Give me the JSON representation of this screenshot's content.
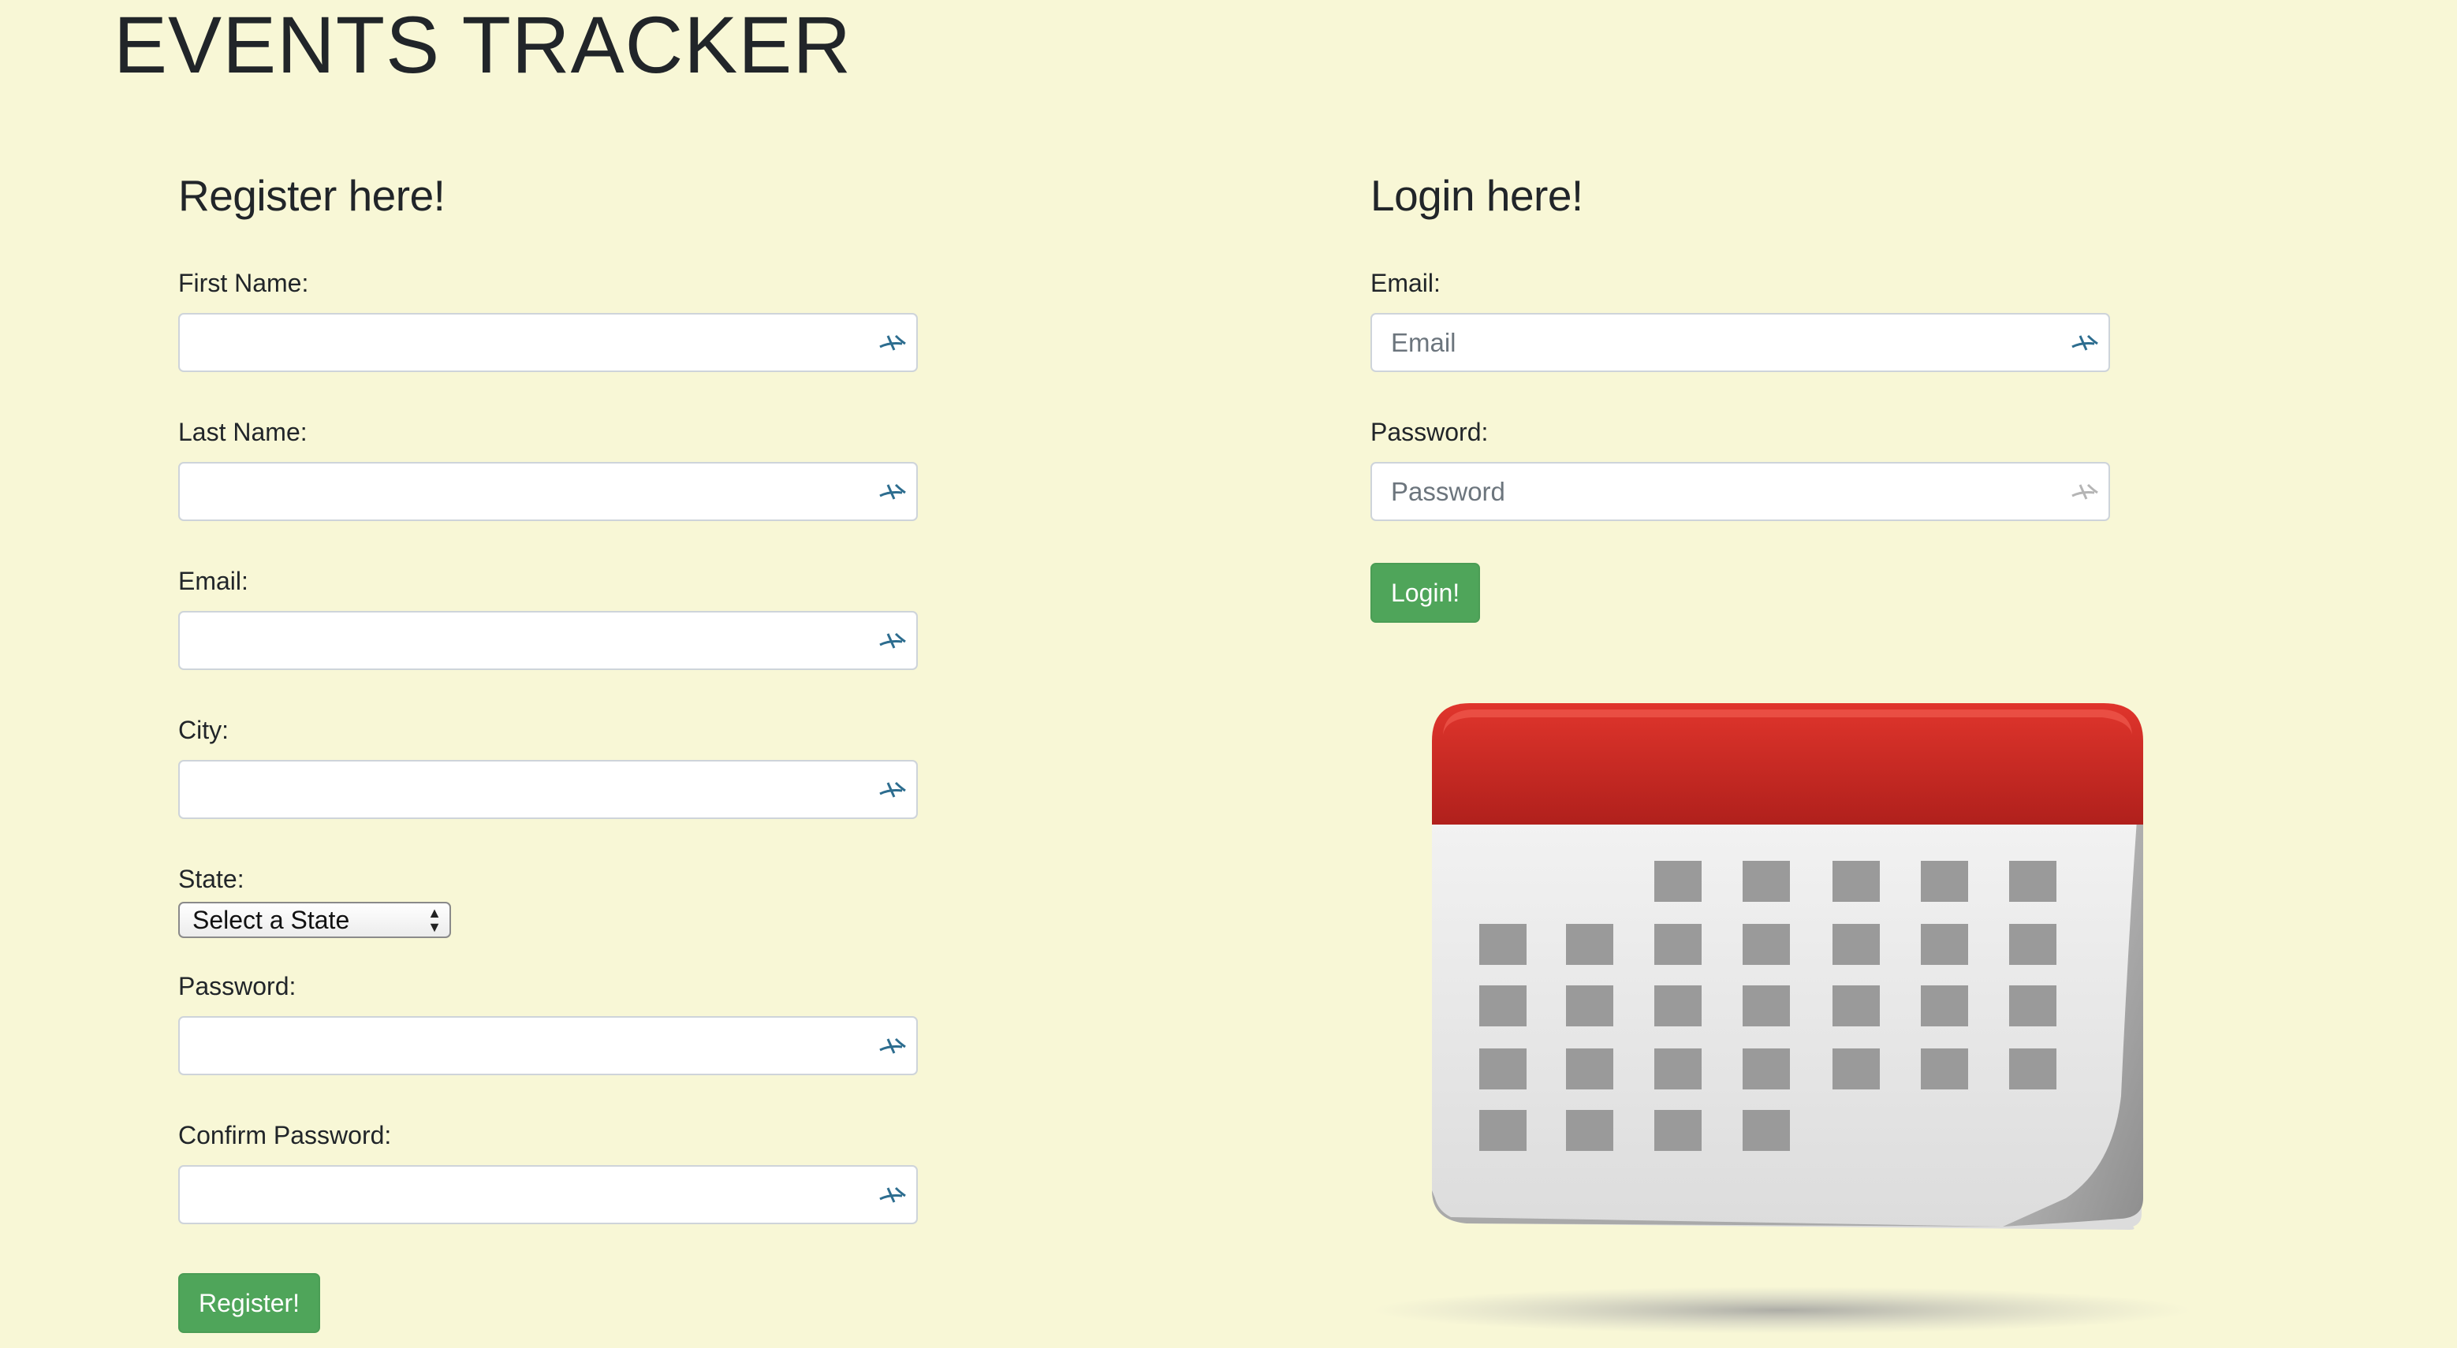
{
  "app": {
    "title": "EVENTS TRACKER"
  },
  "register": {
    "heading": "Register here!",
    "fields": [
      {
        "label": "First Name:",
        "value": "",
        "placeholder": ""
      },
      {
        "label": "Last Name:",
        "value": "",
        "placeholder": ""
      },
      {
        "label": "Email:",
        "value": "",
        "placeholder": ""
      },
      {
        "label": "City:",
        "value": "",
        "placeholder": ""
      }
    ],
    "state": {
      "label": "State:",
      "selected": "Select a State"
    },
    "password": {
      "label": "Password:",
      "value": "",
      "placeholder": ""
    },
    "confirm_password": {
      "label": "Confirm Password:",
      "value": "",
      "placeholder": ""
    },
    "button_label": "Register!"
  },
  "login": {
    "heading": "Login here!",
    "email": {
      "label": "Email:",
      "value": "",
      "placeholder": "Email"
    },
    "password": {
      "label": "Password:",
      "value": "",
      "placeholder": "Password"
    },
    "button_label": "Login!"
  },
  "icons": {
    "autofill": "autofill-icon",
    "illustration": "calendar-icon"
  },
  "colors": {
    "background": "#f8f7d6",
    "button": "#4fa55a",
    "calendar_header": "#c0241f",
    "calendar_day": "#9a9a9a"
  }
}
